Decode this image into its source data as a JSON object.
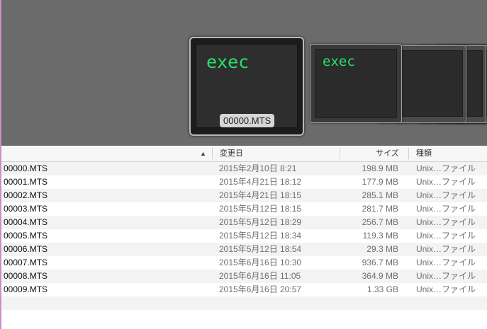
{
  "coverflow": {
    "main_thumb_text": "exec",
    "second_thumb_text": "exec",
    "selected_label": "00000.MTS"
  },
  "columns": {
    "date": "変更日",
    "size": "サイズ",
    "kind": "種類"
  },
  "files": [
    {
      "name": "00000.MTS",
      "date": "2015年2月10日 8:21",
      "size": "198.9 MB",
      "kind": "Unix…ファイル"
    },
    {
      "name": "00001.MTS",
      "date": "2015年4月21日 18:12",
      "size": "177.9 MB",
      "kind": "Unix…ファイル"
    },
    {
      "name": "00002.MTS",
      "date": "2015年4月21日 18:15",
      "size": "285.1 MB",
      "kind": "Unix…ファイル"
    },
    {
      "name": "00003.MTS",
      "date": "2015年5月12日 18:15",
      "size": "281.7 MB",
      "kind": "Unix…ファイル"
    },
    {
      "name": "00004.MTS",
      "date": "2015年5月12日 18:29",
      "size": "256.7 MB",
      "kind": "Unix…ファイル"
    },
    {
      "name": "00005.MTS",
      "date": "2015年5月12日 18:34",
      "size": "119.3 MB",
      "kind": "Unix…ファイル"
    },
    {
      "name": "00006.MTS",
      "date": "2015年5月12日 18:54",
      "size": "29.3 MB",
      "kind": "Unix…ファイル"
    },
    {
      "name": "00007.MTS",
      "date": "2015年6月16日 10:30",
      "size": "936.7 MB",
      "kind": "Unix…ファイル"
    },
    {
      "name": "00008.MTS",
      "date": "2015年6月16日 11:05",
      "size": "364.9 MB",
      "kind": "Unix…ファイル"
    },
    {
      "name": "00009.MTS",
      "date": "2015年6月16日 20:57",
      "size": "1.33 GB",
      "kind": "Unix…ファイル"
    },
    {
      "name": "",
      "date": "",
      "size": "",
      "kind": ""
    },
    {
      "name": "",
      "date": "",
      "size": "",
      "kind": ""
    }
  ]
}
